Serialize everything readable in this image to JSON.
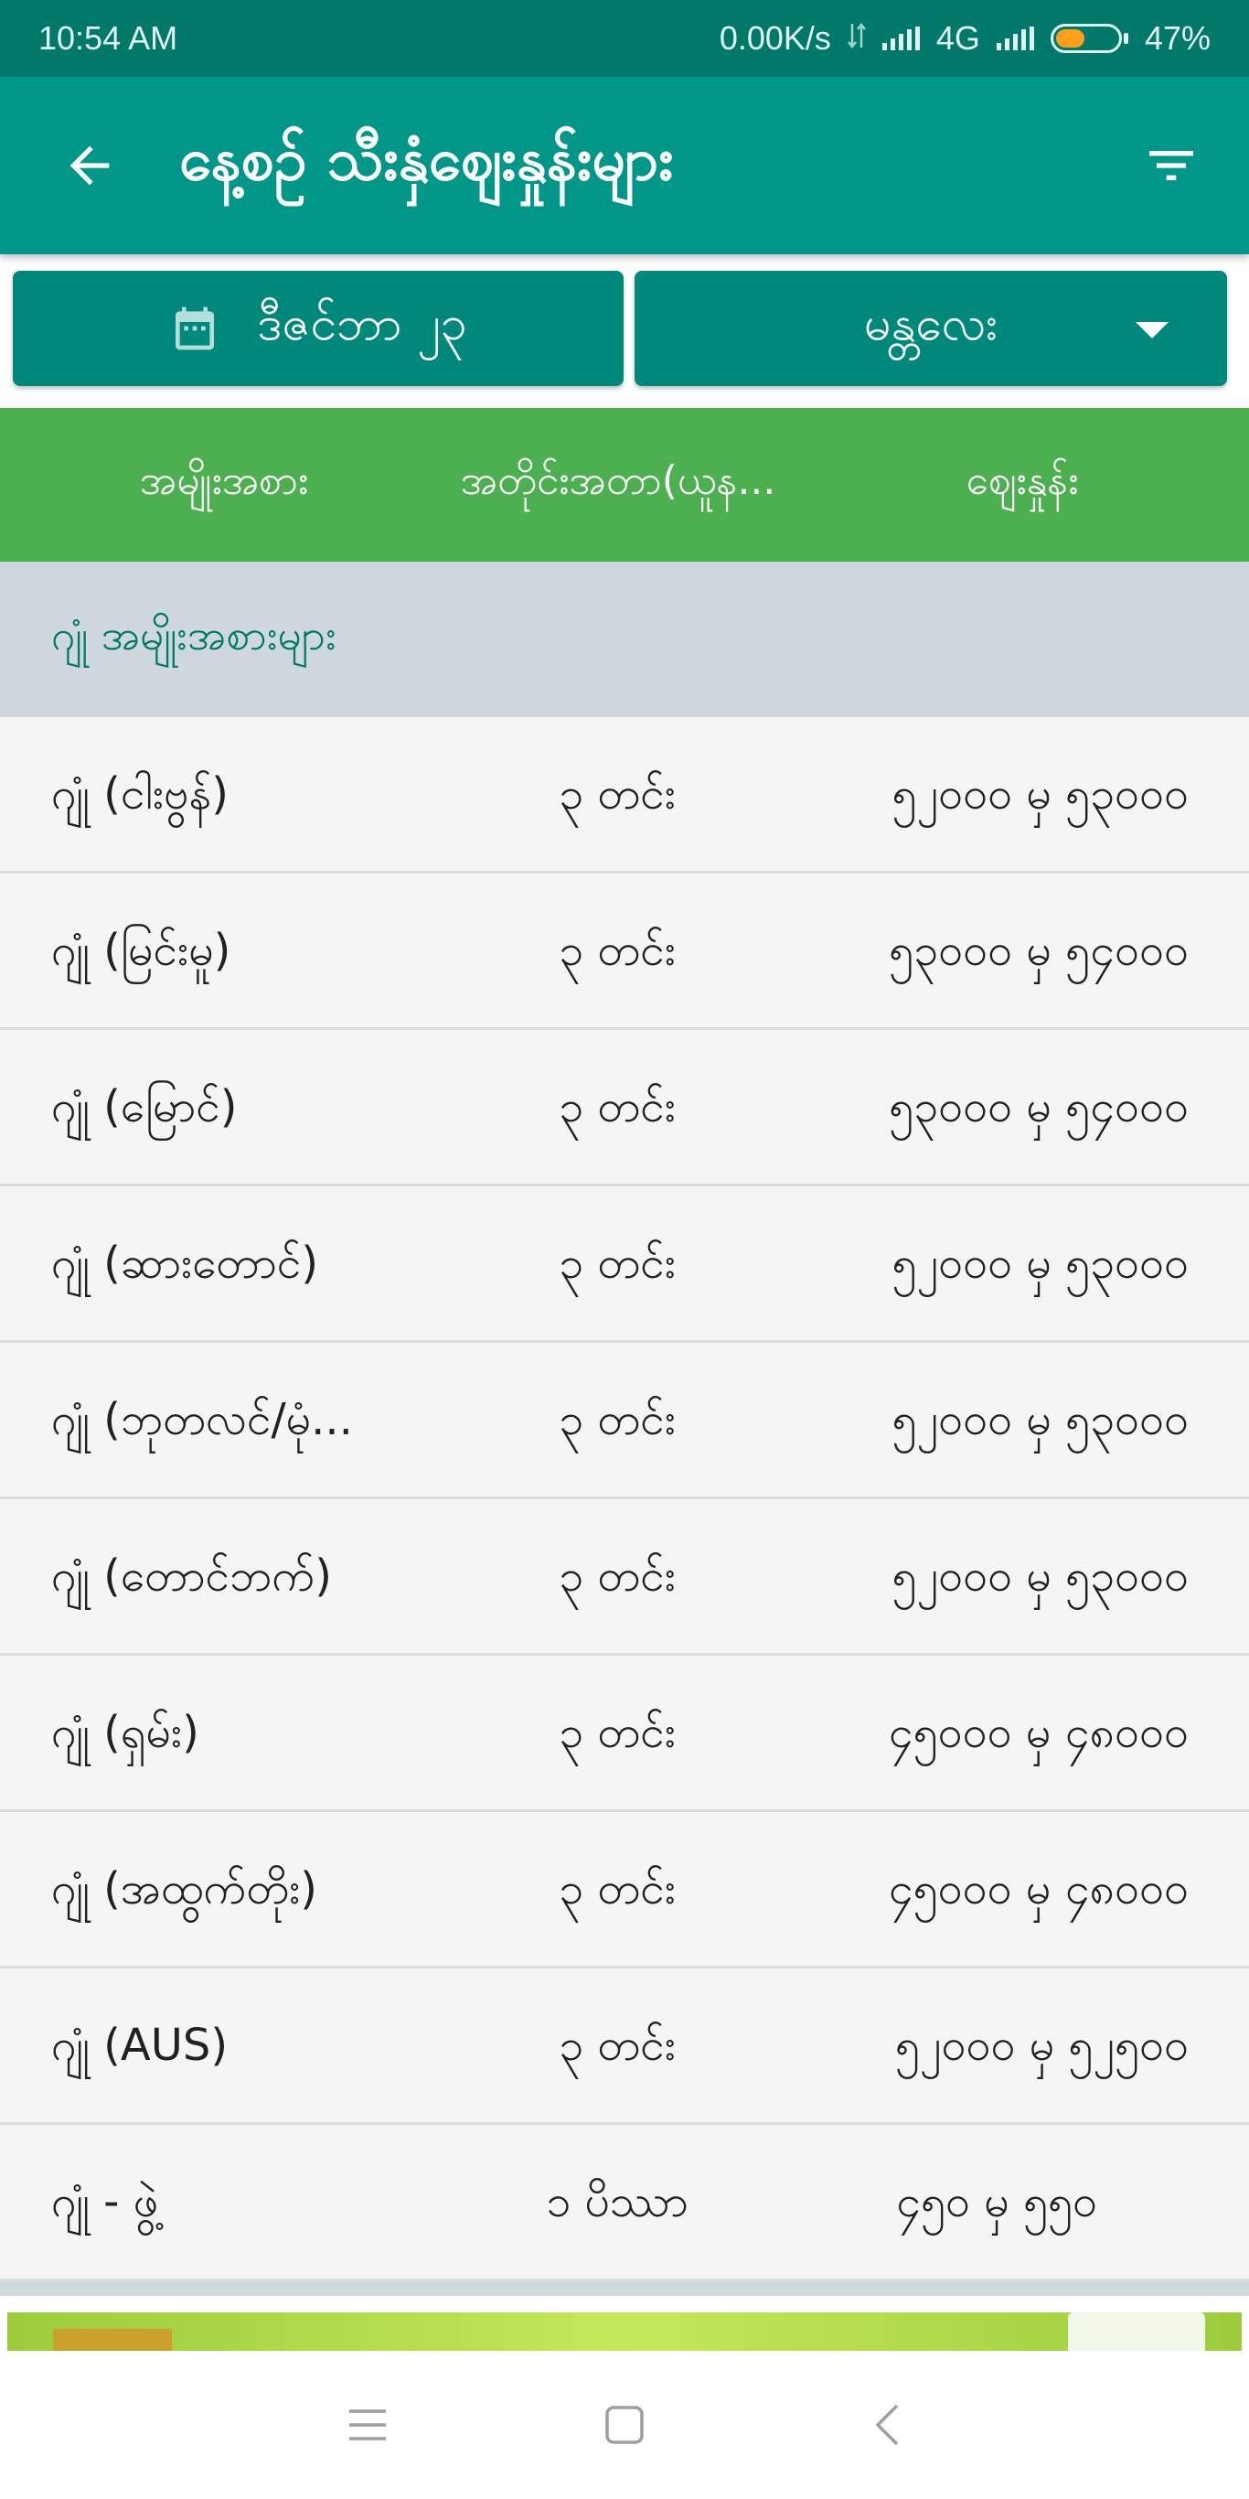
{
  "status_bar": {
    "time": "10:54 AM",
    "net_speed": "0.00K/s",
    "network_type": "4G",
    "battery": "47%",
    "battery_level": 0.47
  },
  "app_bar": {
    "title": "နေ့စဉ် သီးနှံဈေးနှုန်းများ",
    "back_icon": "arrow-left-icon",
    "filter_icon": "filter-icon"
  },
  "selectors": {
    "date_label": "ဒီဇင်ဘာ ၂၃",
    "city_label": "မန္တလေး"
  },
  "columns": {
    "type": "အမျိုးအစား",
    "unit": "အတိုင်းအတာ(ယူန...",
    "price": "ဈေးနှုန်း"
  },
  "group": {
    "title": "ဂျုံ အမျိုးအစားများ"
  },
  "rows": [
    {
      "name": "ဂျုံ (ငါးဗွန်)",
      "unit": "၃ တင်း",
      "price": "၅၂၀၀၀ မှ ၅၃၀၀၀"
    },
    {
      "name": "ဂျုံ (မြင်းမူ)",
      "unit": "၃ တင်း",
      "price": "၅၃၀၀၀ မှ ၅၄၀၀၀"
    },
    {
      "name": "ဂျုံ (မြောင်)",
      "unit": "၃ တင်း",
      "price": "၅၃၀၀၀ မှ ၅၄၀၀၀"
    },
    {
      "name": "ဂျုံ (ဆားတောင်)",
      "unit": "၃ တင်း",
      "price": "၅၂၀၀၀ မှ ၅၃၀၀၀"
    },
    {
      "name": "ဂျုံ (ဘုတလင်/မုံ...",
      "unit": "၃ တင်း",
      "price": "၅၂၀၀၀ မှ ၅၃၀၀၀"
    },
    {
      "name": "ဂျုံ (တောင်ဘက်)",
      "unit": "၃ တင်း",
      "price": "၅၂၀၀၀ မှ ၅၃၀၀၀"
    },
    {
      "name": "ဂျုံ (ရှမ်း)",
      "unit": "၃ တင်း",
      "price": "၄၅၀၀၀ မှ ၄၈၀၀၀"
    },
    {
      "name": "ဂျုံ (အထွက်တိုး)",
      "unit": "၃ တင်း",
      "price": "၄၅၀၀၀ မှ ၄၈၀၀၀"
    },
    {
      "name": "ဂျုံ (AUS)",
      "unit": "၃ တင်း",
      "price": "၅၂၀၀၀ မှ ၅၂၅၀၀"
    },
    {
      "name": "ဂျုံ - ဖွဲ့",
      "unit": "၁ ပိဿာ",
      "price": "၄၅၀ မှ ၅၅၀"
    }
  ],
  "colors": {
    "status_bar": "#00796b",
    "app_bar": "#009688",
    "selector": "#00897b",
    "column_header": "#4caf50",
    "group_header": "#cfd8dc",
    "group_text": "#00796b"
  }
}
